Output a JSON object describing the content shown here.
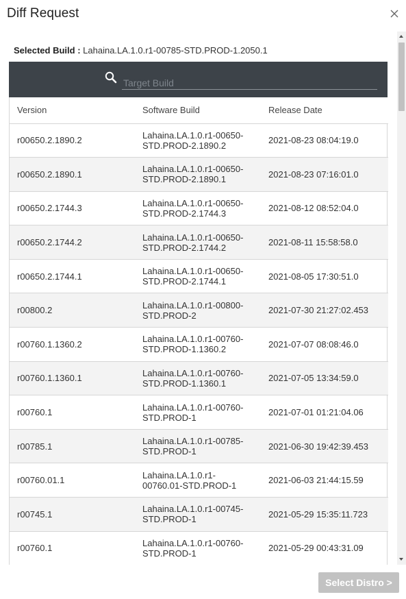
{
  "dialog": {
    "title": "Diff Request",
    "close_icon": "close-icon"
  },
  "selected_build": {
    "label": "Selected Build :",
    "value": "Lahaina.LA.1.0.r1-00785-STD.PROD-1.2050.1"
  },
  "search": {
    "icon": "search-icon",
    "placeholder": "Target Build",
    "value": ""
  },
  "table": {
    "columns": [
      "Version",
      "Software Build",
      "Release Date"
    ],
    "rows": [
      {
        "version": "r00650.2.1890.2",
        "build": "Lahaina.LA.1.0.r1-00650-STD.PROD-2.1890.2",
        "date": "2021-08-23 08:04:19.0"
      },
      {
        "version": "r00650.2.1890.1",
        "build": "Lahaina.LA.1.0.r1-00650-STD.PROD-2.1890.1",
        "date": "2021-08-23 07:16:01.0"
      },
      {
        "version": "r00650.2.1744.3",
        "build": "Lahaina.LA.1.0.r1-00650-STD.PROD-2.1744.3",
        "date": "2021-08-12 08:52:04.0"
      },
      {
        "version": "r00650.2.1744.2",
        "build": "Lahaina.LA.1.0.r1-00650-STD.PROD-2.1744.2",
        "date": "2021-08-11 15:58:58.0"
      },
      {
        "version": "r00650.2.1744.1",
        "build": "Lahaina.LA.1.0.r1-00650-STD.PROD-2.1744.1",
        "date": "2021-08-05 17:30:51.0"
      },
      {
        "version": "r00800.2",
        "build": "Lahaina.LA.1.0.r1-00800-STD.PROD-2",
        "date": "2021-07-30 21:27:02.453"
      },
      {
        "version": "r00760.1.1360.2",
        "build": "Lahaina.LA.1.0.r1-00760-STD.PROD-1.1360.2",
        "date": "2021-07-07 08:08:46.0"
      },
      {
        "version": "r00760.1.1360.1",
        "build": "Lahaina.LA.1.0.r1-00760-STD.PROD-1.1360.1",
        "date": "2021-07-05 13:34:59.0"
      },
      {
        "version": "r00760.1",
        "build": "Lahaina.LA.1.0.r1-00760-STD.PROD-1",
        "date": "2021-07-01 01:21:04.06"
      },
      {
        "version": "r00785.1",
        "build": "Lahaina.LA.1.0.r1-00785-STD.PROD-1",
        "date": "2021-06-30 19:42:39.453"
      },
      {
        "version": "r00760.01.1",
        "build": "Lahaina.LA.1.0.r1-00760.01-STD.PROD-1",
        "date": "2021-06-03 21:44:15.59"
      },
      {
        "version": "r00745.1",
        "build": "Lahaina.LA.1.0.r1-00745-STD.PROD-1",
        "date": "2021-05-29 15:35:11.723"
      },
      {
        "version": "r00760.1",
        "build": "Lahaina.LA.1.0.r1-00760-STD.PROD-1",
        "date": "2021-05-29 00:43:31.09"
      }
    ]
  },
  "footer": {
    "select_distro_label": "Select Distro >",
    "select_distro_enabled": false
  },
  "colors": {
    "search_bar_bg": "#3d4349",
    "row_alt_bg": "#f3f3f3",
    "button_disabled_bg": "#c2c2c2"
  }
}
